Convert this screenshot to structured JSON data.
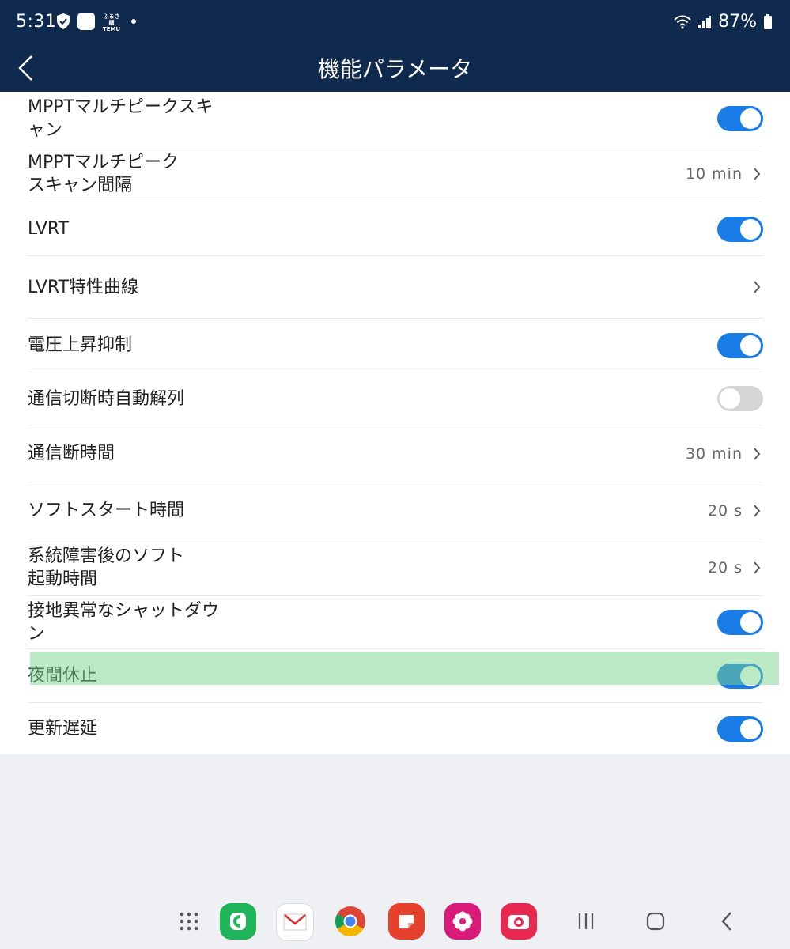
{
  "status_bar": {
    "time": "5:31",
    "temu_label_top": "ふるさ購",
    "temu_label": "TEMU",
    "battery": "87%"
  },
  "header": {
    "title": "機能パラメータ"
  },
  "rows": [
    {
      "label": "MPPTマルチピークスキャン",
      "line1": "MPPTマルチピークスキ",
      "line2": "ャン",
      "control": "toggle",
      "state": "on"
    },
    {
      "label": "MPPTマルチピークスキャン間隔",
      "line1": "MPPTマルチピーク",
      "line2": "スキャン間隔",
      "control": "value",
      "value": "10 min"
    },
    {
      "label": "LVRT",
      "control": "toggle",
      "state": "on"
    },
    {
      "label": "LVRT特性曲線",
      "control": "chevron"
    },
    {
      "label": "電圧上昇抑制",
      "control": "toggle",
      "state": "on"
    },
    {
      "label": "通信切断時自動解列",
      "control": "toggle",
      "state": "off"
    },
    {
      "label": "通信断時間",
      "control": "value",
      "value": "30 min"
    },
    {
      "label": "ソフトスタート時間",
      "control": "value",
      "value": "20 s"
    },
    {
      "label": "系統障害後のソフト起動時間",
      "line1": "系統障害後のソフト",
      "line2": "起動時間",
      "control": "value",
      "value": "20 s"
    },
    {
      "label": "接地異常なシャットダウン",
      "line1": "接地異常なシャットダウ",
      "line2": "ン",
      "control": "toggle",
      "state": "on"
    },
    {
      "label": "夜間休止",
      "control": "toggle",
      "state": "on",
      "highlighted": true
    },
    {
      "label": "更新遅延",
      "control": "toggle",
      "state": "on"
    }
  ],
  "nav_bar": {
    "items": [
      "apps-grid-icon",
      "phone-app-icon",
      "mail-app-icon",
      "chrome-app-icon",
      "notes-app-icon",
      "gallery-app-icon",
      "camera-app-icon",
      "recents-icon",
      "home-icon",
      "back-icon"
    ]
  },
  "colors": {
    "header_bg": "#0f2a4c",
    "toggle_on": "#1a7ce6",
    "toggle_off": "#d6d6d6",
    "highlight": "#7fd496"
  }
}
